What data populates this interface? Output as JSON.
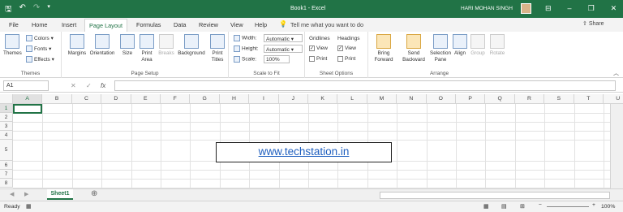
{
  "titlebar": {
    "title": "Book1 - Excel",
    "user": "HARI MOHAN SINGH"
  },
  "tabs": [
    "File",
    "Home",
    "Insert",
    "Page Layout",
    "Formulas",
    "Data",
    "Review",
    "View",
    "Help"
  ],
  "tellme": "Tell me what you want to do",
  "share": "Share",
  "ribbon": {
    "themes": {
      "themes_label": "Themes",
      "colors": "Colors",
      "fonts": "Fonts",
      "effects": "Effects",
      "group": "Themes"
    },
    "page_setup": {
      "margins": "Margins",
      "orientation": "Orientation",
      "size": "Size",
      "print_area": "Print Area",
      "breaks": "Breaks",
      "background": "Background",
      "print_titles": "Print Titles",
      "group": "Page Setup"
    },
    "scale": {
      "width_label": "Width:",
      "width_value": "Automatic",
      "height_label": "Height:",
      "height_value": "Automatic",
      "scale_label": "Scale:",
      "scale_value": "100%",
      "group": "Scale to Fit"
    },
    "sheet_options": {
      "gridlines": "Gridlines",
      "headings": "Headings",
      "view": "View",
      "print": "Print",
      "group": "Sheet Options"
    },
    "arrange": {
      "bring_forward": "Bring Forward",
      "send_backward": "Send Backward",
      "selection_pane": "Selection Pane",
      "align": "Align",
      "group_btn": "Group",
      "rotate": "Rotate",
      "group": "Arrange"
    }
  },
  "namebox": "A1",
  "columns": [
    "A",
    "B",
    "C",
    "D",
    "E",
    "F",
    "G",
    "H",
    "I",
    "J",
    "K",
    "L",
    "M",
    "N",
    "O",
    "P",
    "Q",
    "R",
    "S",
    "T",
    "U"
  ],
  "rows": [
    "1",
    "2",
    "3",
    "4",
    "5",
    "6",
    "7",
    "8"
  ],
  "textbox_text": "www.techstation.in",
  "sheet_tab": "Sheet1",
  "status": {
    "ready": "Ready",
    "zoom": "100%"
  }
}
